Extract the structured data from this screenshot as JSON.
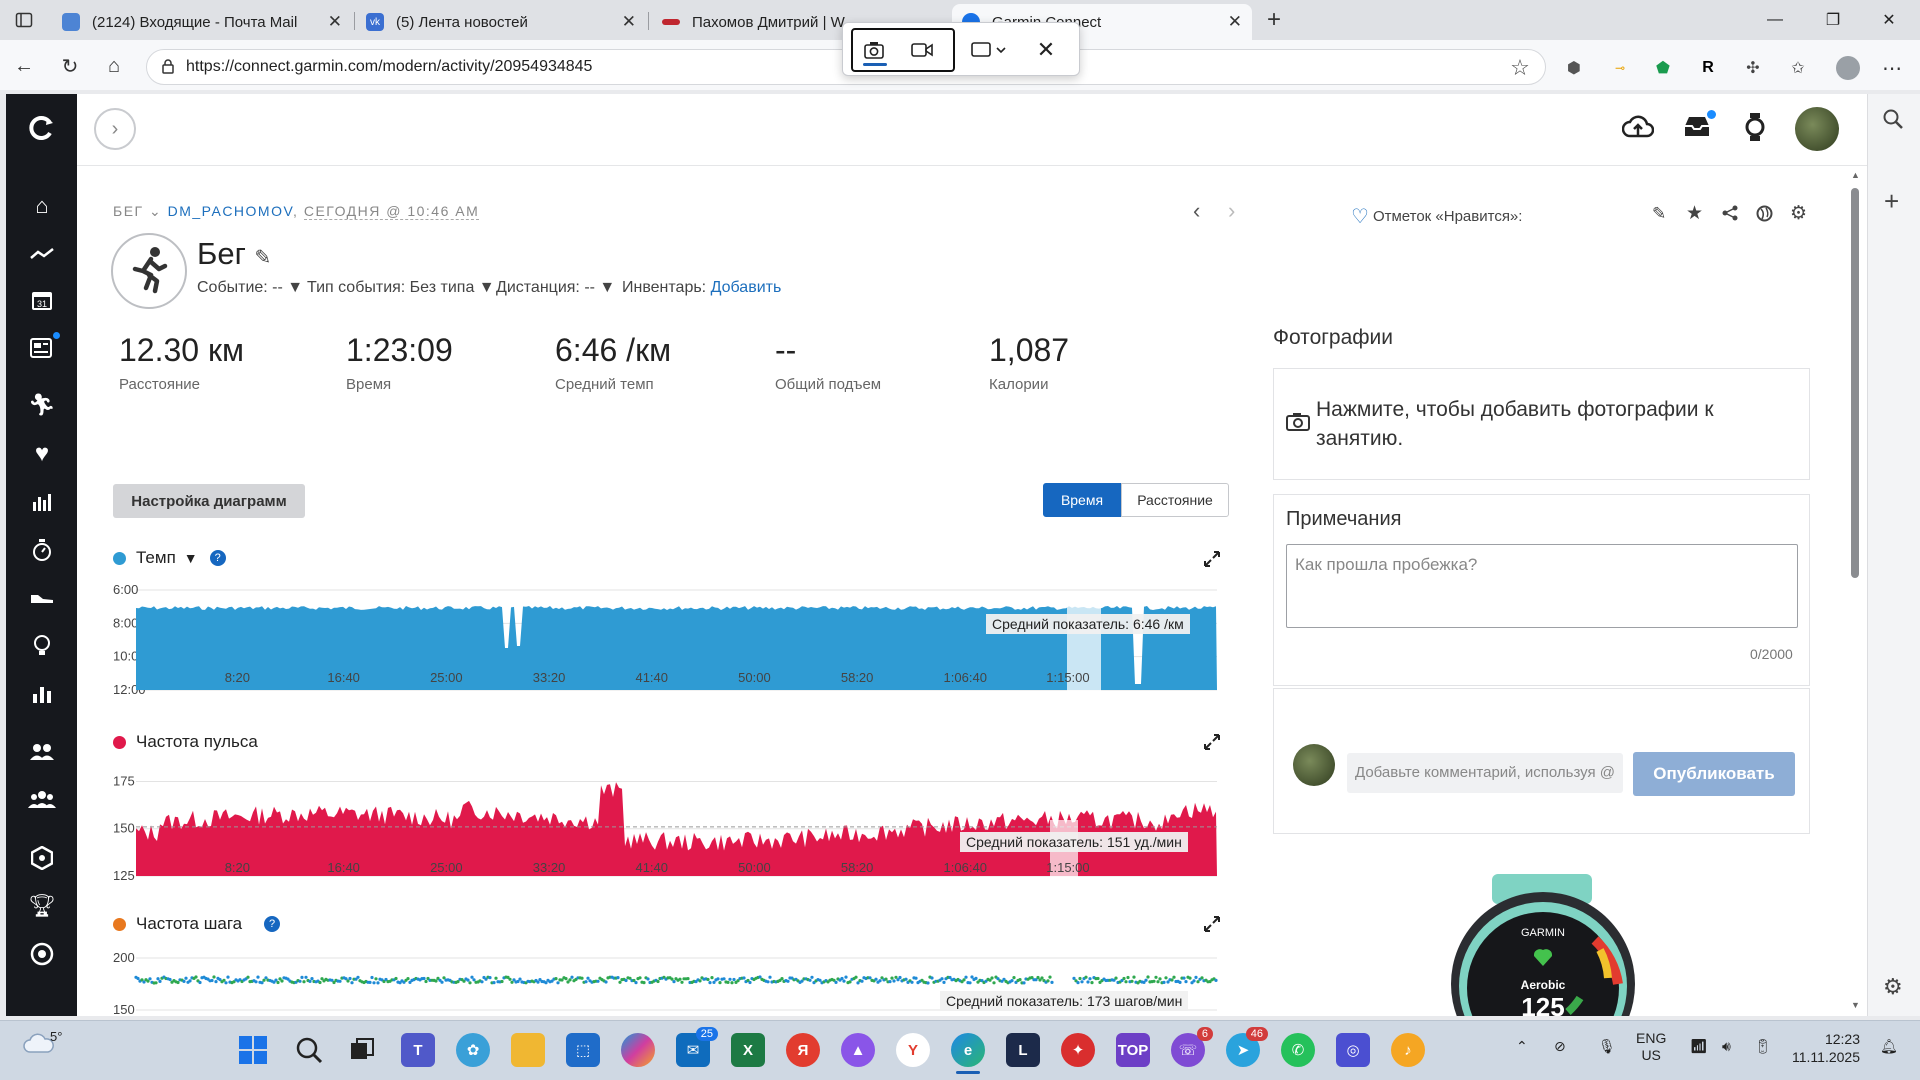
{
  "browser": {
    "tabs": [
      {
        "label": "(2124) Входящие - Почта Mail",
        "color": "#4d84d4"
      },
      {
        "label": "(5) Лента новостей",
        "color": "#3b6fd1"
      },
      {
        "label": "Пахомов Дмитрий | W...",
        "color": "#c0262f"
      },
      {
        "label": "Garmin Connect",
        "color": "#ffffff"
      }
    ],
    "url": "https://connect.garmin.com/modern/activity/20954934845"
  },
  "activity": {
    "breadcrumb_sport": "БЕГ",
    "breadcrumb_user": "DM_PACHOMOV",
    "breadcrumb_time": "СЕГОДНЯ @ 10:46 AM",
    "title": "Бег",
    "event_label": "Событие: --",
    "event_type_label": "Тип события: Без типа",
    "distance_label": "Дистанция: --",
    "gear_label": "Инвентарь:",
    "gear_add": "Добавить",
    "likes_label": "Отметок «Нравится»:"
  },
  "stats": [
    {
      "value": "12.30 км",
      "label": "Расстояние"
    },
    {
      "value": "1:23:09",
      "label": "Время"
    },
    {
      "value": "6:46 /км",
      "label": "Средний темп"
    },
    {
      "value": "--",
      "label": "Общий подъем"
    },
    {
      "value": "1,087",
      "label": "Калории"
    }
  ],
  "controls": {
    "chart_settings": "Настройка диаграмм",
    "toggle_time": "Время",
    "toggle_distance": "Расстояние"
  },
  "charts": {
    "pace_title": "Темп",
    "pace_avg": "Средний показатель: 6:46 /км",
    "hr_title": "Частота пульса",
    "hr_avg": "Средний показатель: 151 уд./мин",
    "cadence_title": "Частота шага",
    "cadence_avg": "Средний показатель: 173 шагов/мин",
    "x_ticks": [
      "8:20",
      "16:40",
      "25:00",
      "33:20",
      "41:40",
      "50:00",
      "58:20",
      "1:06:40",
      "1:15:00"
    ],
    "pace_y_ticks": [
      "6:00",
      "8:00",
      "10:00",
      "12:00"
    ],
    "hr_y_ticks": [
      "175",
      "150",
      "125"
    ],
    "cadence_y_ticks": [
      "200",
      "150"
    ]
  },
  "chart_data": [
    {
      "type": "area",
      "series": [
        {
          "name": "Темп",
          "color": "#2f9bd3"
        }
      ],
      "yticks": [
        "6:00",
        "8:00",
        "10:00",
        "12:00"
      ],
      "y_inverted": true,
      "xticks": [
        "8:20",
        "16:40",
        "25:00",
        "33:20",
        "41:40",
        "50:00",
        "58:20",
        "1:06:40",
        "1:15:00"
      ],
      "annotation": "Средний показатель: 6:46 /км"
    },
    {
      "type": "area",
      "series": [
        {
          "name": "Частота пульса",
          "color": "#e0194b"
        }
      ],
      "yticks": [
        175,
        150,
        125
      ],
      "ylim": [
        125,
        180
      ],
      "average": 151,
      "xticks": [
        "8:20",
        "16:40",
        "25:00",
        "33:20",
        "41:40",
        "50:00",
        "58:20",
        "1:06:40",
        "1:15:00"
      ],
      "annotation": "Средний показатель: 151 уд./мин"
    },
    {
      "type": "scatter",
      "series": [
        {
          "name": "Частота шага"
        }
      ],
      "yticks": [
        200,
        150
      ],
      "average": 173,
      "annotation": "Средний показатель: 173 шагов/мин"
    }
  ],
  "side": {
    "photos_title": "Фотографии",
    "photos_hint": "Нажмите, чтобы добавить фотографии к занятию.",
    "notes_title": "Примечания",
    "notes_placeholder": "Как прошла пробежка?",
    "notes_count": "0/2000",
    "comment_placeholder": "Добавьте комментарий, используя @",
    "publish": "Опубликовать",
    "watch_brand": "GARMIN",
    "watch_mode": "Aerobic",
    "watch_value": "125"
  },
  "taskbar": {
    "weather": "5°",
    "lang_top": "ENG",
    "lang_bottom": "US",
    "time": "12:23",
    "date": "11.11.2025",
    "badges": {
      "outlook": "25",
      "viber": "6",
      "telegram": "46"
    }
  }
}
